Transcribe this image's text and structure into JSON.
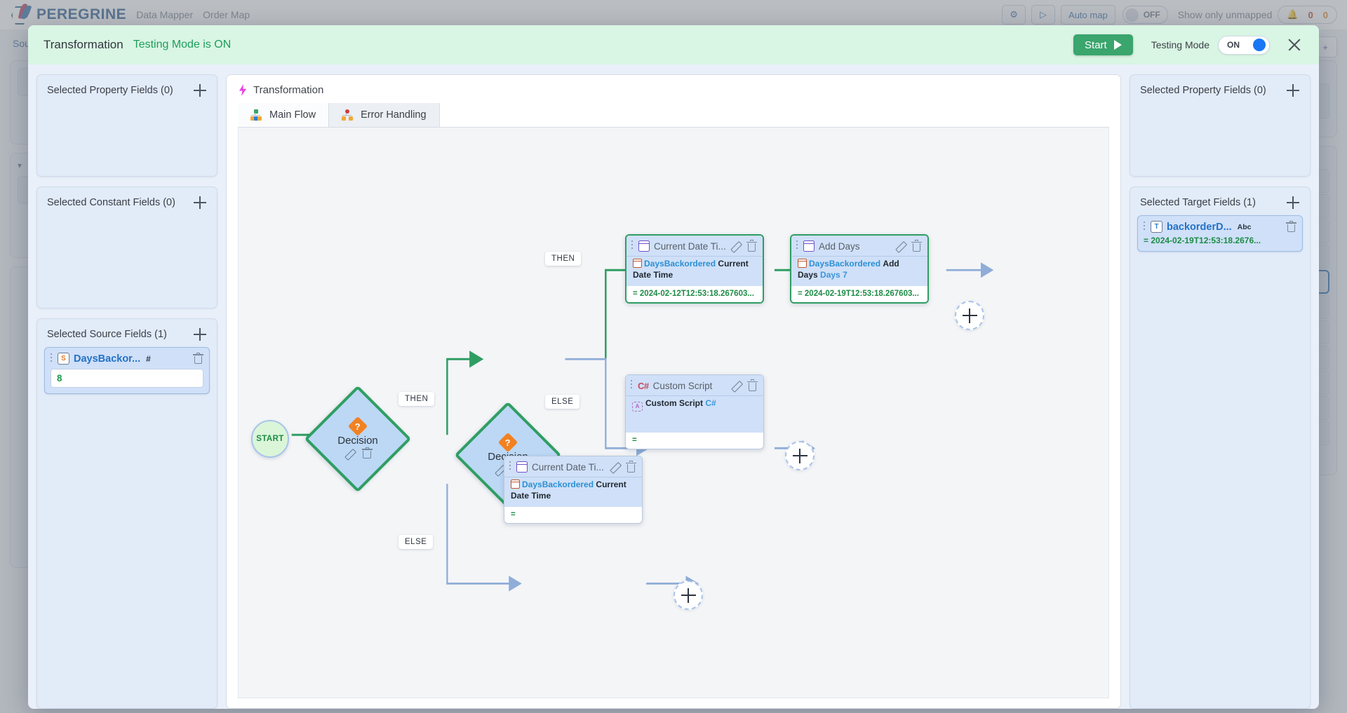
{
  "background": {
    "brand": "PEREGRINE",
    "breadcrumb_app": "Data Mapper",
    "breadcrumb_map": "Order Map",
    "gear_icon": "gear-icon",
    "run_icon": "play-icon",
    "automap_label": "Auto map",
    "automap_toggle": "OFF",
    "unmapped_label": "Show only unmapped",
    "bell_icon": "bell-icon",
    "count_error": "0",
    "count_warn": "0",
    "source_label": "Source"
  },
  "modal": {
    "title": "Transformation",
    "status": "Testing Mode is ON",
    "start_label": "Start",
    "testing_mode_label": "Testing Mode",
    "testing_mode_value": "ON",
    "close_icon": "close-icon"
  },
  "left_panels": [
    {
      "title": "Selected Property Fields (0)",
      "add_icon": "plus-icon"
    },
    {
      "title": "Selected Constant Fields (0)",
      "add_icon": "plus-icon"
    },
    {
      "title": "Selected Source Fields (1)",
      "add_icon": "plus-icon"
    }
  ],
  "source_field": {
    "name": "DaysBackor...",
    "type_badge": "#",
    "type_icon": "number-field-icon",
    "value": "8",
    "delete_icon": "trash-icon"
  },
  "right_panels": [
    {
      "title": "Selected Property Fields (0)",
      "add_icon": "plus-icon"
    },
    {
      "title": "Selected Target Fields (1)",
      "add_icon": "plus-icon"
    }
  ],
  "target_field": {
    "name": "backorderD...",
    "type_badge": "Abc",
    "type_icon": "text-field-icon",
    "value": "= 2024-02-19T12:53:18.2676...",
    "delete_icon": "trash-icon"
  },
  "canvas": {
    "header": "Transformation",
    "header_icon": "bolt-icon",
    "tabs": [
      {
        "label": "Main Flow",
        "icon": "flow-tree-icon",
        "active": true
      },
      {
        "label": "Error Handling",
        "icon": "error-tree-icon",
        "active": false
      }
    ]
  },
  "flow": {
    "start_label": "START",
    "decision_1": {
      "label": "Decision",
      "badge": "?",
      "edit_icon": "pencil-icon",
      "delete_icon": "trash-icon"
    },
    "decision_2": {
      "label": "Decision",
      "badge": "?",
      "edit_icon": "pencil-icon",
      "delete_icon": "trash-icon"
    },
    "edge_labels": {
      "d1_then": "THEN",
      "d1_else": "ELSE",
      "d2_then": "THEN",
      "d2_else": "ELSE"
    },
    "node_current_date": {
      "title": "Current Date Ti...",
      "icon": "calendar-icon",
      "field": "DaysBackordered",
      "operation": "Current Date Time",
      "value": "= 2024-02-12T12:53:18.267603...",
      "edit_icon": "pencil-icon",
      "delete_icon": "trash-icon"
    },
    "node_add_days": {
      "title": "Add Days",
      "icon": "calendar-icon",
      "field": "DaysBackordered",
      "operation": "Add Days",
      "param_label": "Days",
      "param_value": "7",
      "value": "= 2024-02-19T12:53:18.267603...",
      "edit_icon": "pencil-icon",
      "delete_icon": "trash-icon"
    },
    "node_custom_script": {
      "title": "Custom Script",
      "icon": "csharp-icon",
      "operation": "Custom Script",
      "language": "C#",
      "value": "=",
      "edit_icon": "pencil-icon",
      "delete_icon": "trash-icon"
    },
    "node_current_date_2": {
      "title": "Current Date Ti...",
      "icon": "calendar-icon",
      "field": "DaysBackordered",
      "operation": "Current Date Time",
      "value": "=",
      "edit_icon": "pencil-icon",
      "delete_icon": "trash-icon"
    },
    "add_node_label": "+"
  }
}
